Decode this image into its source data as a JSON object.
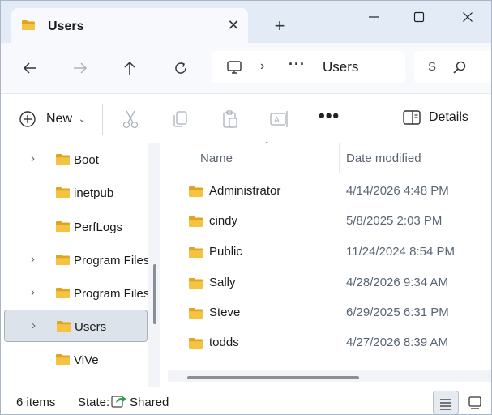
{
  "tab": {
    "title": "Users",
    "close_glyph": "✕",
    "icon": "folder-icon"
  },
  "new_tab_glyph": "+",
  "window_controls": {
    "minimize": "—",
    "maximize": "☐",
    "close": "✕"
  },
  "address": {
    "separator": "›",
    "overflow": "···",
    "current": "Users"
  },
  "search": {
    "placeholder_fragment": "S"
  },
  "commands": {
    "new_label": "New",
    "new_caret": "⌄",
    "more_glyph": "•••",
    "details_label": "Details"
  },
  "navigation_pane": {
    "items": [
      {
        "label": "Boot",
        "expandable": true,
        "selected": false
      },
      {
        "label": "inetpub",
        "expandable": false,
        "selected": false
      },
      {
        "label": "PerfLogs",
        "expandable": false,
        "selected": false
      },
      {
        "label": "Program Files",
        "expandable": true,
        "selected": false
      },
      {
        "label": "Program Files",
        "expandable": true,
        "selected": false
      },
      {
        "label": "Users",
        "expandable": true,
        "selected": true
      },
      {
        "label": "ViVe",
        "expandable": false,
        "selected": false
      }
    ]
  },
  "columns": {
    "name": "Name",
    "date_modified": "Date modified",
    "sort_glyph": "⌃"
  },
  "files": [
    {
      "name": "Administrator",
      "date_modified": "4/14/2026 4:48 PM"
    },
    {
      "name": "cindy",
      "date_modified": "5/8/2025 2:03 PM"
    },
    {
      "name": "Public",
      "date_modified": "11/24/2024 8:54 PM"
    },
    {
      "name": "Sally",
      "date_modified": "4/28/2026 9:34 AM"
    },
    {
      "name": "Steve",
      "date_modified": "6/29/2025 6:31 PM"
    },
    {
      "name": "todds",
      "date_modified": "4/27/2026 8:39 AM"
    }
  ],
  "status": {
    "item_count": "6 items",
    "state_label": "State:",
    "state_value": "Shared"
  },
  "colors": {
    "folder": "#f5c342",
    "folder_dark": "#e0a520",
    "accent": "#0f6cbd",
    "tab_strip": "#e3ebf6",
    "share_green": "#2e9d4f"
  }
}
